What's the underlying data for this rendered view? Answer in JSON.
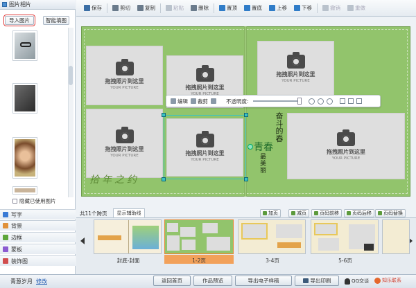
{
  "left_panel": {
    "title": "图片相片",
    "import_btn": "导入图片",
    "smart_btn": "智能填图",
    "hide_used": "隐藏已使用图片",
    "categories": [
      {
        "label": "写字",
        "color": "#3a7bd5"
      },
      {
        "label": "背景",
        "color": "#e0913a"
      },
      {
        "label": "边框",
        "color": "#5da63a"
      },
      {
        "label": "蒙板",
        "color": "#8c5bd1"
      },
      {
        "label": "装饰图",
        "color": "#d14d4d"
      }
    ]
  },
  "toolbar": {
    "items": [
      {
        "label": "保存",
        "color": "#3b6ea5",
        "enabled": true
      },
      {
        "label": "剪切",
        "color": "#6a7b8c",
        "enabled": true
      },
      {
        "label": "复制",
        "color": "#6a7b8c",
        "enabled": true
      },
      {
        "label": "粘贴",
        "color": "#b9c2cc",
        "enabled": false
      },
      {
        "label": "删除",
        "color": "#6a7b8c",
        "enabled": true
      },
      {
        "label": "置顶",
        "color": "#2f7cc8",
        "enabled": true
      },
      {
        "label": "置底",
        "color": "#2f7cc8",
        "enabled": true
      },
      {
        "label": "上移",
        "color": "#2f7cc8",
        "enabled": true
      },
      {
        "label": "下移",
        "color": "#2f7cc8",
        "enabled": true
      },
      {
        "label": "撤销",
        "color": "#b9c2cc",
        "enabled": false
      },
      {
        "label": "重做",
        "color": "#b9c2cc",
        "enabled": false
      }
    ]
  },
  "canvas": {
    "slot_text": "拖拽照片到这里",
    "slot_sub": "YOUR PICTURE",
    "edit_bar": {
      "edit": "编辑",
      "crop": "裁剪",
      "opacity_label": "不透明度:"
    },
    "verse_1": "奋斗的春",
    "verse_2": "青春",
    "verse_3": "最美丽",
    "bottom_text": "拾年之约"
  },
  "page_strip": {
    "page_count": "共11个跨页",
    "aux_tab": "显示辅助线",
    "buttons": [
      "加页",
      "减页",
      "页码前移",
      "页码后移",
      "页码替换"
    ],
    "labels": [
      "封底-封面",
      "1-2页",
      "3-4页",
      "5-6页"
    ]
  },
  "status": {
    "title": "青葱岁月",
    "edit_link": "修改",
    "buttons": [
      "返回首页",
      "作品预览",
      "导出电子样稿",
      "导出印刷"
    ],
    "qq": "QQ交谈",
    "logo": "知乐联系"
  }
}
